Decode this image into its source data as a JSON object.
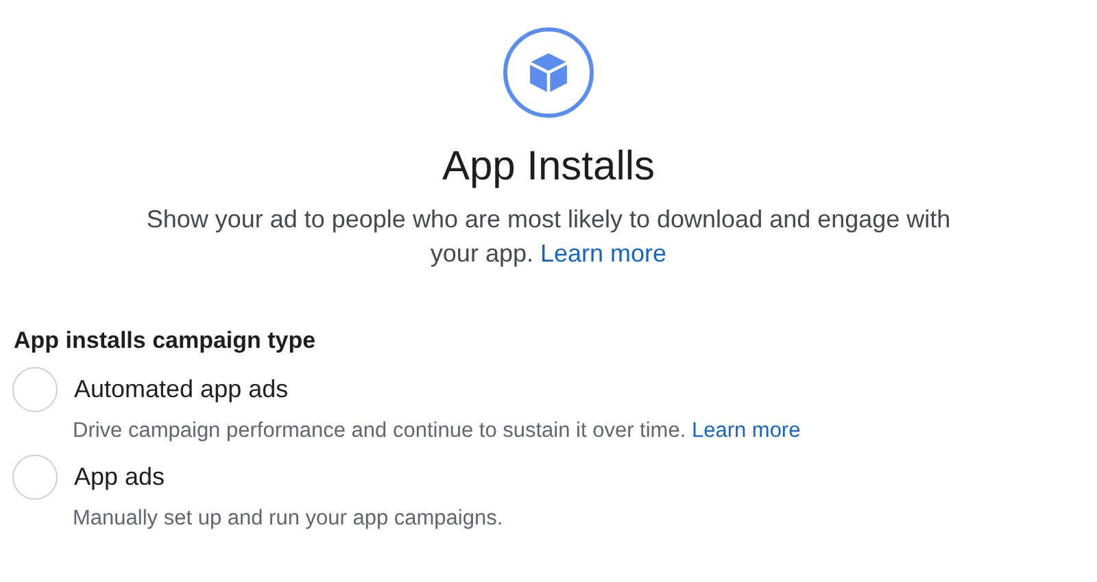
{
  "header": {
    "title": "App Installs",
    "description": "Show your ad to people who are most likely to download and engage with your app.",
    "link": "Learn more"
  },
  "campaign_type": {
    "label": "App installs campaign type",
    "options": [
      {
        "label": "Automated app ads",
        "description": "Drive campaign performance and continue to sustain it over time.",
        "link": "Learn more",
        "selected": false
      },
      {
        "label": "App ads",
        "description": "Manually set up and run your app campaigns.",
        "selected": false
      }
    ]
  }
}
